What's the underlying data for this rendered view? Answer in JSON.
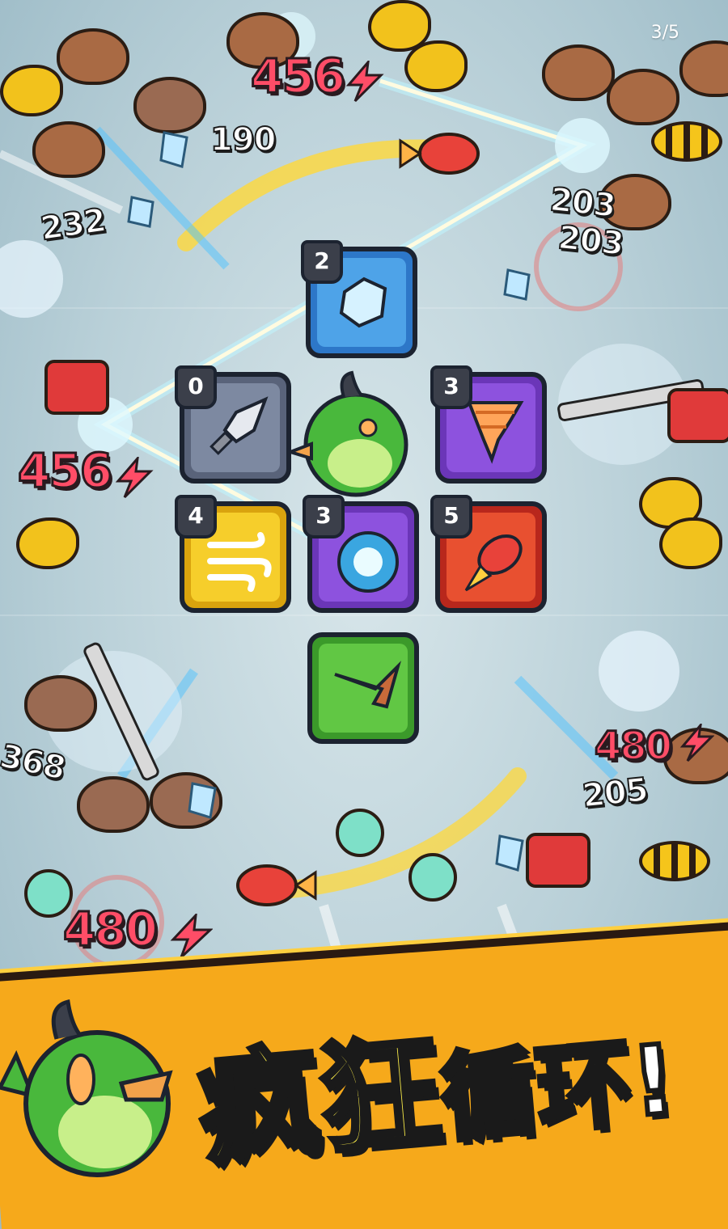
{
  "pager": {
    "text": "3/5"
  },
  "tiles": [
    {
      "level": "2",
      "icon": "ice-cube-icon"
    },
    {
      "level": "0",
      "icon": "dagger-icon"
    },
    {
      "level": "3",
      "icon": "tornado-icon"
    },
    {
      "level": "4",
      "icon": "wind-gust-icon"
    },
    {
      "level": "3",
      "icon": "vortex-orb-icon"
    },
    {
      "level": "5",
      "icon": "rocket-fish-icon"
    },
    {
      "level": "",
      "icon": "boomerang-icon"
    }
  ],
  "damage_numbers": {
    "big": [
      "456",
      "456",
      "480",
      "480"
    ],
    "small": [
      "190",
      "232",
      "203",
      "203",
      "368",
      "205"
    ]
  },
  "banner": {
    "title_part1": "疯狂",
    "title_part2": "循环!"
  },
  "colors": {
    "damage_crit": "#ff4d67",
    "banner_orange": "#f6a91b",
    "slogan_yellow": "#fff14a",
    "lightning": "#fffbe0",
    "trail_yellow": "#ffd83a"
  }
}
